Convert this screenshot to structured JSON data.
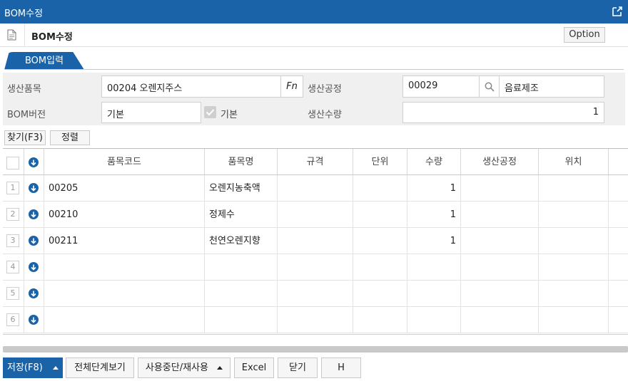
{
  "window": {
    "title": "BOM수정",
    "popout_icon": "external-link-icon"
  },
  "header": {
    "doc_icon": "document-icon",
    "title": "BOM수정",
    "option_label": "Option"
  },
  "tab": {
    "label": "BOM입력"
  },
  "form": {
    "product_label": "생산품목",
    "product_value": "00204 오렌지주스",
    "fn_label": "Fn",
    "process_label": "생산공정",
    "process_code": "00029",
    "process_name": "음료제조",
    "version_label": "BOM버전",
    "version_value": "기본",
    "default_checkbox_label": "기본",
    "default_checked": true,
    "qty_label": "생산수량",
    "qty_value": "1"
  },
  "toolbar": {
    "find_label": "찾기(F3)",
    "sort_label": "정렬"
  },
  "grid": {
    "columns": [
      "품목코드",
      "품목명",
      "규격",
      "단위",
      "수량",
      "생산공정",
      "위치"
    ],
    "rows": [
      {
        "num": "1",
        "code": "00205",
        "name": "오렌지농축액",
        "spec": "",
        "unit": "",
        "qty": "1",
        "process": "",
        "location": ""
      },
      {
        "num": "2",
        "code": "00210",
        "name": "정제수",
        "spec": "",
        "unit": "",
        "qty": "1",
        "process": "",
        "location": ""
      },
      {
        "num": "3",
        "code": "00211",
        "name": "천연오렌지향",
        "spec": "",
        "unit": "",
        "qty": "1",
        "process": "",
        "location": ""
      },
      {
        "num": "4",
        "code": "",
        "name": "",
        "spec": "",
        "unit": "",
        "qty": "",
        "process": "",
        "location": ""
      },
      {
        "num": "5",
        "code": "",
        "name": "",
        "spec": "",
        "unit": "",
        "qty": "",
        "process": "",
        "location": ""
      },
      {
        "num": "6",
        "code": "",
        "name": "",
        "spec": "",
        "unit": "",
        "qty": "",
        "process": "",
        "location": ""
      }
    ]
  },
  "footer": {
    "save_label": "저장(F8)",
    "view_all_label": "전체단계보기",
    "suspend_label": "사용중단/재사용",
    "excel_label": "Excel",
    "close_label": "닫기",
    "h_label": "H"
  },
  "colors": {
    "accent": "#1b63a8"
  }
}
